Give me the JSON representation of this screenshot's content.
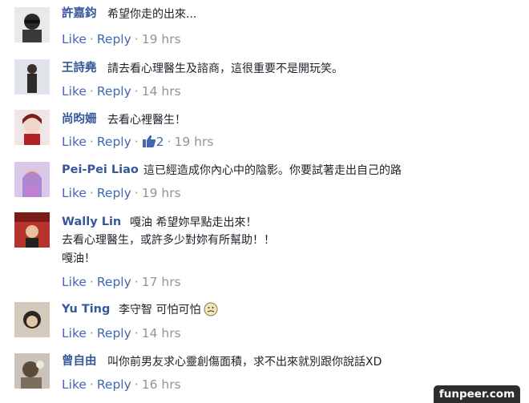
{
  "comments": [
    {
      "name": "許嘉鈞",
      "lines": [
        "希望你走的出來..."
      ],
      "like": "Like",
      "reply": "Reply",
      "time": "19 hrs"
    },
    {
      "name": "王詩堯",
      "lines": [
        "請去看心理醫生及諮商，這很重要不是開玩笑。"
      ],
      "like": "Like",
      "reply": "Reply",
      "time": "14 hrs"
    },
    {
      "name": "尚昀姍",
      "lines": [
        "去看心裡醫生！"
      ],
      "like": "Like",
      "reply": "Reply",
      "likes_count": "2",
      "time": "19 hrs"
    },
    {
      "name": "Pei-Pei Liao",
      "lines": [
        "這已經造成你內心中的陰影。你要試著走出自己的路"
      ],
      "like": "Like",
      "reply": "Reply",
      "time": "19 hrs"
    },
    {
      "name": "Wally Lin",
      "lines": [
        "嘎油 希望妳早點走出來！",
        "去看心理醫生，或許多少對妳有所幫助！！",
        "嘎油！"
      ],
      "like": "Like",
      "reply": "Reply",
      "time": "17 hrs"
    },
    {
      "name": "Yu Ting",
      "lines": [
        "李守智 可怕可怕"
      ],
      "like": "Like",
      "reply": "Reply",
      "time": "14 hrs"
    },
    {
      "name": "曾自由",
      "lines": [
        "叫你前男友求心靈創傷面積，求不出來就別跟你說話XD"
      ],
      "like": "Like",
      "reply": "Reply",
      "time": "16 hrs"
    }
  ],
  "watermark": "funpeer.com",
  "colors": {
    "name": "#365899",
    "link": "#4267b2",
    "meta": "#90949c"
  }
}
